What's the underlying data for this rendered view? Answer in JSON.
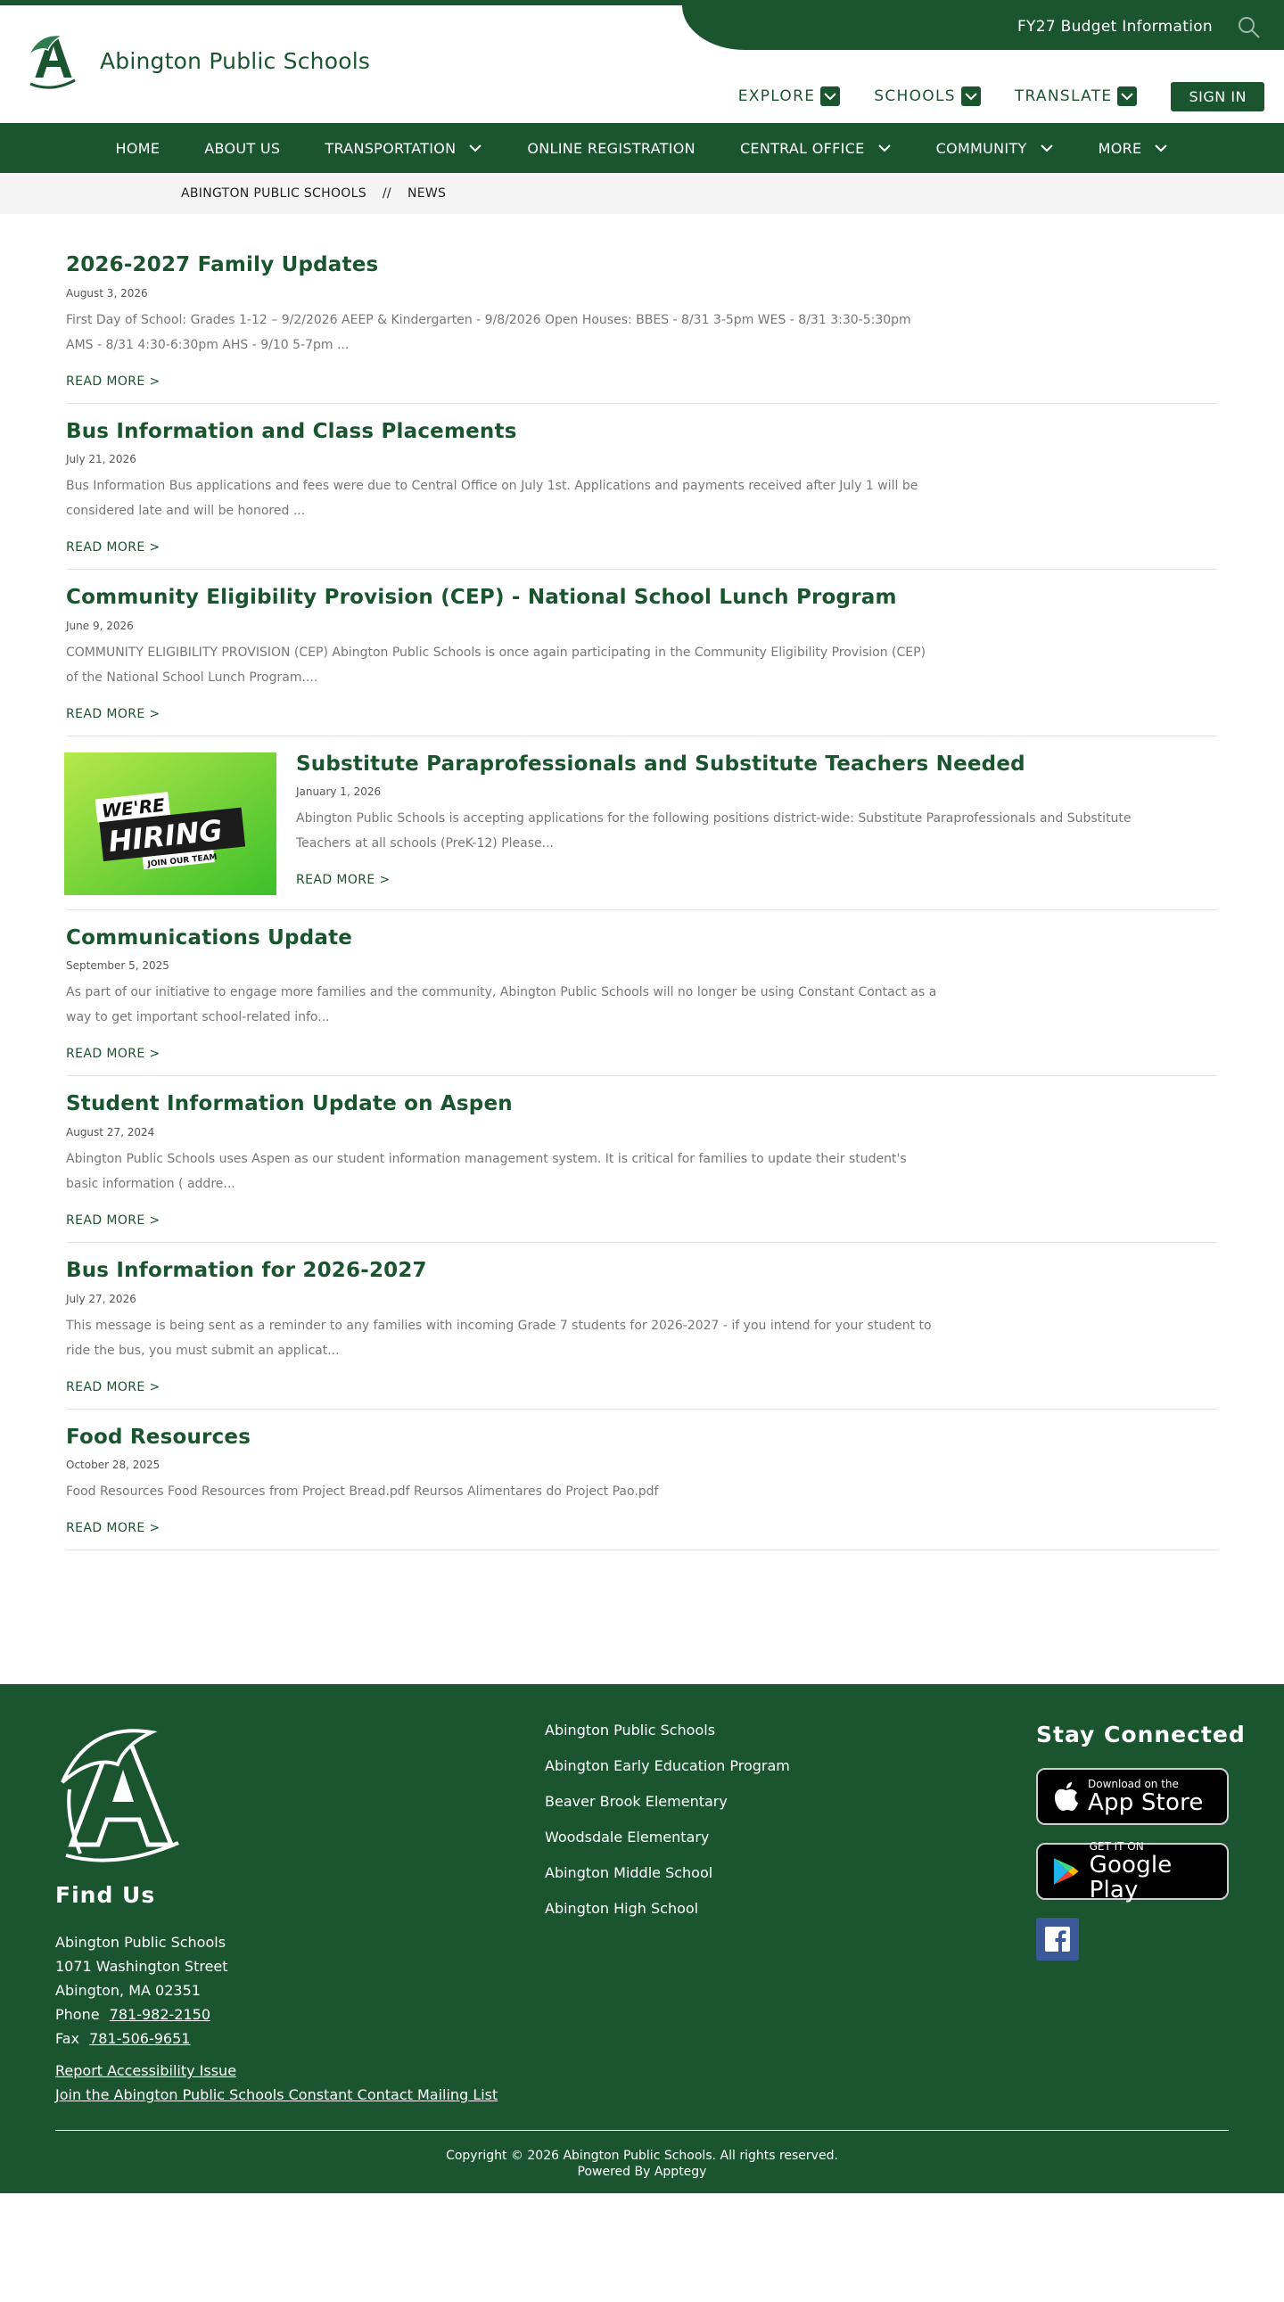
{
  "header": {
    "site_title": "Abington Public Schools",
    "budget_link": "FY27 Budget Information",
    "utility_nav": [
      {
        "label": "EXPLORE"
      },
      {
        "label": "SCHOOLS"
      },
      {
        "label": "TRANSLATE"
      }
    ],
    "sign_in": "SIGN IN",
    "brand_color": "#1b5530"
  },
  "main_nav": [
    {
      "label": "HOME",
      "dropdown": false
    },
    {
      "label": "ABOUT US",
      "dropdown": false
    },
    {
      "label": "TRANSPORTATION",
      "dropdown": true
    },
    {
      "label": "ONLINE REGISTRATION",
      "dropdown": false
    },
    {
      "label": "CENTRAL OFFICE",
      "dropdown": true
    },
    {
      "label": "COMMUNITY",
      "dropdown": true
    },
    {
      "label": "MORE",
      "dropdown": true
    }
  ],
  "breadcrumb": {
    "home": "ABINGTON PUBLIC SCHOOLS",
    "separator": "//",
    "current": "NEWS"
  },
  "news": [
    {
      "title": "2026-2027 Family Updates",
      "date": "August 3, 2026",
      "summary": "First Day of School: Grades 1-12 – 9/2/2026 AEEP & Kindergarten - 9/8/2026 Open Houses: BBES - 8/31 3-5pm WES - 8/31 3:30-5:30pm AMS - 8/31 4:30-6:30pm AHS - 9/10 5-7pm ...",
      "read_more": "READ MORE >"
    },
    {
      "title": "Bus Information and Class Placements",
      "date": "July 21, 2026",
      "summary": "Bus Information Bus applications and fees were due to Central Office on July 1st. Applications and payments received after July 1 will be considered late and will be honored ...",
      "read_more": "READ MORE >"
    },
    {
      "title": "Community Eligibility Provision (CEP) - National School Lunch Program",
      "date": "June 9, 2026",
      "summary": "COMMUNITY ELIGIBILITY PROVISION (CEP) Abington Public Schools is once again participating in the Community Eligibility Provision (CEP) of the National School Lunch Program....",
      "read_more": "READ MORE >"
    },
    {
      "title": "Substitute Paraprofessionals and Substitute Teachers Needed",
      "date": "January 1, 2026",
      "summary": "Abington Public Schools is accepting applications for the following positions district-wide: Substitute Paraprofessionals and Substitute Teachers at all schools (PreK-12) Please...",
      "read_more": "READ MORE >",
      "thumb": {
        "line1": "WE'RE",
        "line2": "HIRING",
        "line3": "JOIN OUR TEAM"
      }
    },
    {
      "title": "Communications Update",
      "date": "September 5, 2025",
      "summary": "As part of our initiative to engage more families and the community, Abington Public Schools will no longer be using Constant Contact as a way to get important school-related info...",
      "read_more": "READ MORE >"
    },
    {
      "title": "Student Information Update on Aspen",
      "date": "August 27, 2024",
      "summary": "Abington Public Schools uses Aspen as our student information management system. It is critical for families to update their student's basic information ( addre...",
      "read_more": "READ MORE >"
    },
    {
      "title": "Bus Information for 2026-2027",
      "date": "July 27, 2026",
      "summary": "This message is being sent as a reminder to any families with incoming Grade 7 students for 2026-2027 - if you intend for your student to ride the bus, you must submit an applicat...",
      "read_more": "READ MORE >"
    },
    {
      "title": "Food Resources",
      "date": "October 28, 2025",
      "summary": "Food Resources Food Resources from Project Bread.pdf  Reursos Alimentares do Project Pao.pdf",
      "read_more": "READ MORE >"
    }
  ],
  "footer": {
    "find_us": "Find Us",
    "address": {
      "name": "Abington Public Schools",
      "street": "1071 Washington Street",
      "city": "Abington, MA 02351",
      "phone_label": "Phone",
      "phone": "781-982-2150",
      "fax_label": "Fax",
      "fax": "781-506-9651"
    },
    "links": [
      "Report Accessibility Issue",
      "Join the Abington Public Schools Constant Contact Mailing List"
    ],
    "schools": [
      "Abington Public Schools",
      "Abington Early Education Program",
      "Beaver Brook Elementary",
      "Woodsdale Elementary",
      "Abington Middle School",
      "Abington High School"
    ],
    "stay_connected": "Stay Connected",
    "app_store": {
      "small": "Download on the",
      "big": "App Store"
    },
    "google_play": {
      "small": "GET IT ON",
      "big": "Google Play"
    },
    "copyright": "Copyright © 2026 Abington Public Schools. All rights reserved.",
    "powered_by": "Powered By Apptegy"
  }
}
